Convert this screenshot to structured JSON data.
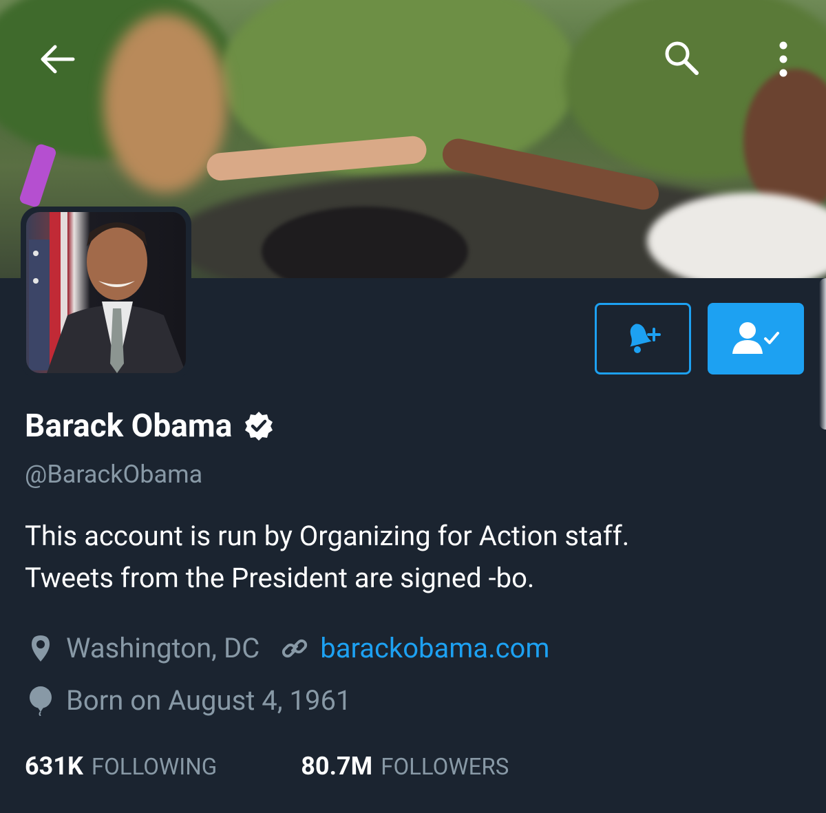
{
  "app": {
    "accent": "#1da1f2",
    "background": "#1b2430",
    "muted_text": "#8899a6"
  },
  "topbar": {
    "back_icon": "arrow-left-icon",
    "search_icon": "search-icon",
    "more_icon": "more-vertical-icon"
  },
  "banner": {
    "description_icon": "header-photo"
  },
  "actions": {
    "notify_icon": "bell-plus-icon",
    "following_icon": "user-check-icon"
  },
  "profile": {
    "name": "Barack Obama",
    "handle": "@BarackObama",
    "bio_lines": [
      "This account is run by Organizing for Action staff.",
      "Tweets from the President are signed -bo."
    ],
    "location": "Washington, DC",
    "website": "barackobama.com",
    "birthday": "Born on August 4, 1961"
  },
  "stats": {
    "following_count": "631K",
    "following_label": "FOLLOWING",
    "followers_count": "80.7M",
    "followers_label": "FOLLOWERS"
  }
}
